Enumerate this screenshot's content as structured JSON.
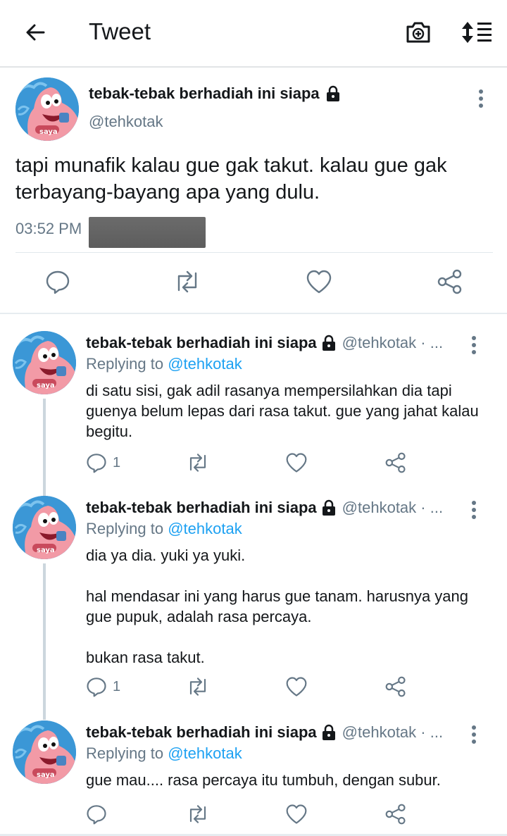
{
  "header": {
    "title": "Tweet",
    "back_icon": "arrow-left-icon",
    "camera_icon": "camera-add-icon",
    "sort_icon": "sort-icon"
  },
  "main_tweet": {
    "display_name": "tebak-tebak berhadiah ini siapa",
    "handle": "@tehkotak",
    "avatar_label": "saya",
    "text": "tapi munafik kalau gue gak takut. kalau gue gak terbayang-bayang apa yang dulu.",
    "time": "03:52 PM",
    "actions": {
      "reply_icon": "comment-icon",
      "retweet_icon": "retweet-icon",
      "like_icon": "heart-icon",
      "share_icon": "share-icon"
    }
  },
  "replies": [
    {
      "display_name": "tebak-tebak berhadiah ini siapa",
      "handle": "@tehkotak · ...",
      "avatar_label": "saya",
      "replying_prefix": "Replying to",
      "replying_to": "@tehkotak",
      "text": "di satu sisi, gak adil rasanya mempersilahkan dia tapi guenya belum lepas dari rasa takut. gue yang jahat kalau begitu.",
      "reply_count": "1"
    },
    {
      "display_name": "tebak-tebak berhadiah ini siapa",
      "handle": "@tehkotak · ...",
      "avatar_label": "saya",
      "replying_prefix": "Replying to",
      "replying_to": "@tehkotak",
      "text": "dia ya dia. yuki ya yuki.\n\nhal mendasar ini yang harus gue tanam. harusnya yang gue pupuk, adalah rasa percaya.\n\nbukan rasa takut.",
      "reply_count": "1"
    },
    {
      "display_name": "tebak-tebak berhadiah ini siapa",
      "handle": "@tehkotak · ...",
      "avatar_label": "saya",
      "replying_prefix": "Replying to",
      "replying_to": "@tehkotak",
      "text": "gue mau.... rasa percaya itu tumbuh, dengan subur.",
      "reply_count": ""
    }
  ],
  "colors": {
    "text": "#14171a",
    "muted": "#657786",
    "link": "#1da1f2",
    "border": "#e1e8ed"
  }
}
